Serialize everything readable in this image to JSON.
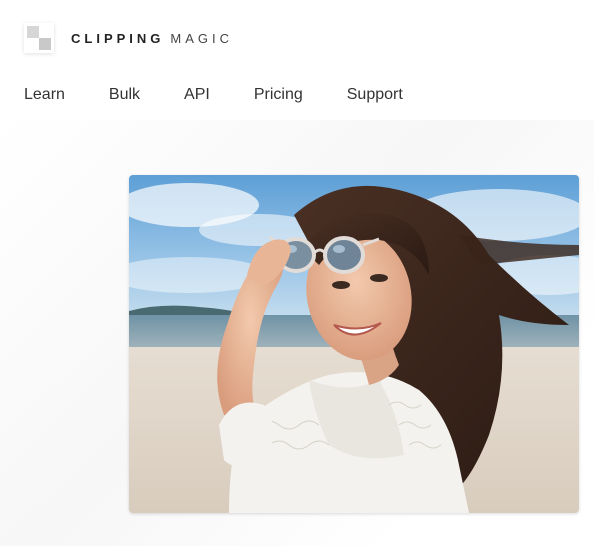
{
  "brand": {
    "name_bold": "CLIPPING",
    "name_light": "MAGIC"
  },
  "nav": {
    "items": [
      {
        "label": "Learn"
      },
      {
        "label": "Bulk"
      },
      {
        "label": "API"
      },
      {
        "label": "Pricing"
      },
      {
        "label": "Support"
      }
    ]
  },
  "hero": {
    "subject": "woman with sunglasses on beach"
  }
}
